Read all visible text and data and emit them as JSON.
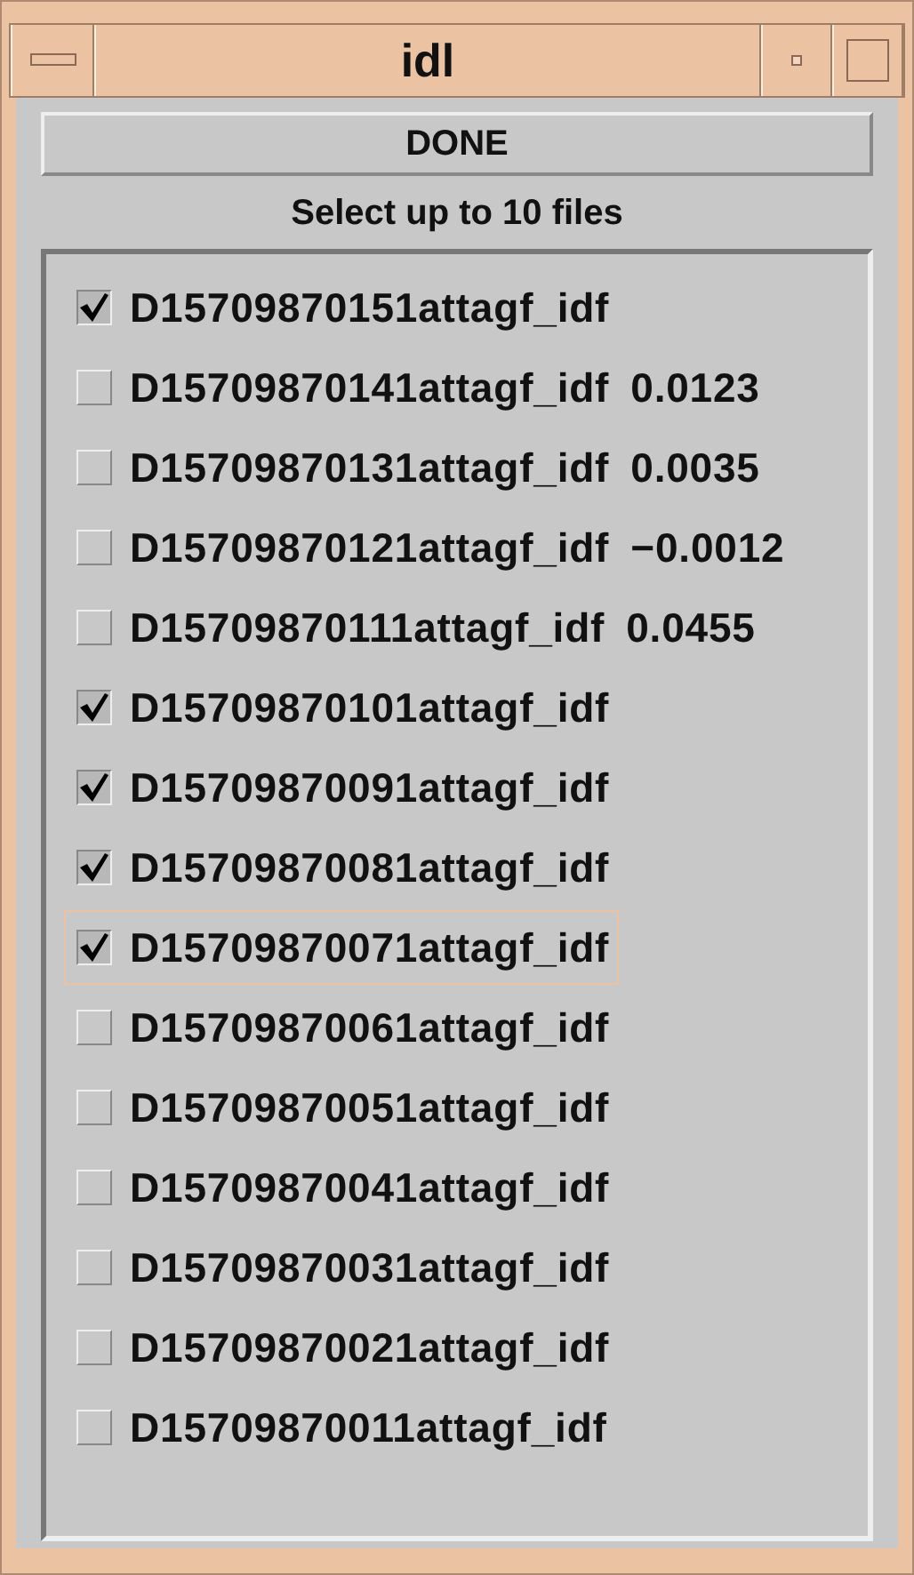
{
  "window": {
    "title": "idl"
  },
  "done_button": "DONE",
  "instruction": "Select up to 10 files",
  "files": [
    {
      "name": "D15709870151attagf_idf",
      "checked": true,
      "focused": false
    },
    {
      "name": "D15709870141attagf_idf",
      "value": "0.0123",
      "checked": false,
      "focused": false
    },
    {
      "name": "D15709870131attagf_idf",
      "value": "0.0035",
      "checked": false,
      "focused": false
    },
    {
      "name": "D15709870121attagf_idf",
      "value": "−0.0012",
      "checked": false,
      "focused": false
    },
    {
      "name": "D15709870111attagf_idf",
      "value": "0.0455",
      "checked": false,
      "focused": false
    },
    {
      "name": "D15709870101attagf_idf",
      "checked": true,
      "focused": false
    },
    {
      "name": "D15709870091attagf_idf",
      "checked": true,
      "focused": false
    },
    {
      "name": "D15709870081attagf_idf",
      "checked": true,
      "focused": false
    },
    {
      "name": "D15709870071attagf_idf",
      "checked": true,
      "focused": true
    },
    {
      "name": "D15709870061attagf_idf",
      "checked": false,
      "focused": false
    },
    {
      "name": "D15709870051attagf_idf",
      "checked": false,
      "focused": false
    },
    {
      "name": "D15709870041attagf_idf",
      "checked": false,
      "focused": false
    },
    {
      "name": "D15709870031attagf_idf",
      "checked": false,
      "focused": false
    },
    {
      "name": "D15709870021attagf_idf",
      "checked": false,
      "focused": false
    },
    {
      "name": "D15709870011attagf_idf",
      "checked": false,
      "focused": false
    }
  ]
}
